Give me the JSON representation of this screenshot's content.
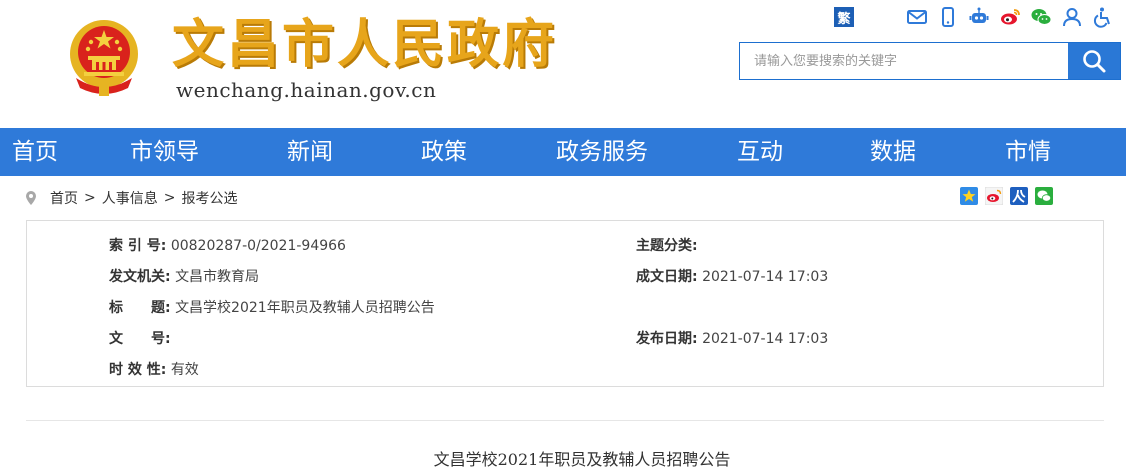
{
  "header": {
    "site_title": "文昌市人民政府",
    "site_url": "wenchang.hainan.gov.cn",
    "traditional_label": "繁",
    "search": {
      "placeholder": "请输入您要搜索的关键字",
      "value": ""
    },
    "icon_names": [
      "mail-icon",
      "mobile-icon",
      "robot-icon",
      "weibo-icon",
      "wechat-icon",
      "user-icon",
      "accessibility-icon"
    ]
  },
  "nav": {
    "items": [
      {
        "label": "首页"
      },
      {
        "label": "市领导"
      },
      {
        "label": "新闻"
      },
      {
        "label": "政策"
      },
      {
        "label": "政务服务"
      },
      {
        "label": "互动"
      },
      {
        "label": "数据"
      },
      {
        "label": "市情"
      }
    ]
  },
  "breadcrumb": {
    "items": [
      "首页",
      "人事信息",
      "报考公选"
    ],
    "separator": ">"
  },
  "share_icons": [
    "qzone-share-icon",
    "weibo-share-icon",
    "renren-share-icon",
    "wechat-share-icon"
  ],
  "info": {
    "index_no": {
      "label": "索 引 号:",
      "value": "00820287-0/2021-94966"
    },
    "topic": {
      "label": "主题分类:",
      "value": ""
    },
    "issuer": {
      "label": "发文机关:",
      "value": "文昌市教育局"
    },
    "created_date": {
      "label": "成文日期:",
      "value": "2021-07-14 17:03"
    },
    "title": {
      "label": "标　　题:",
      "value": "文昌学校2021年职员及教辅人员招聘公告"
    },
    "doc_no": {
      "label": "文　　号:",
      "value": ""
    },
    "publish_date": {
      "label": "发布日期:",
      "value": "2021-07-14 17:03"
    },
    "validity": {
      "label": "时 效 性:",
      "value": "有效"
    }
  },
  "article": {
    "title": "文昌学校2021年职员及教辅人员招聘公告"
  },
  "colors": {
    "nav_bg": "#2f7ad9",
    "title_gold": "#e7a51b",
    "accent_blue": "#1d5fb5"
  }
}
